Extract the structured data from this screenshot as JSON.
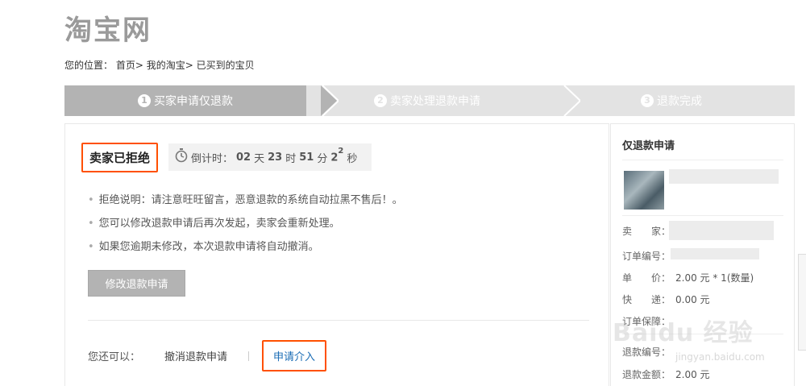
{
  "logo": "淘宝网",
  "breadcrumb": {
    "prefix": "您的位置：",
    "items": [
      "首页",
      "我的淘宝",
      "已买到的宝贝"
    ],
    "sep": "> "
  },
  "steps": [
    {
      "num": "1",
      "label": "买家申请仅退款"
    },
    {
      "num": "2",
      "label": "卖家处理退款申请"
    },
    {
      "num": "3",
      "label": "退款完成"
    }
  ],
  "status": {
    "title": "卖家已拒绝",
    "countdown_label": "倒计时：",
    "days": "02",
    "days_unit": "天",
    "hours": "23",
    "hours_unit": "时",
    "minutes": "51",
    "minutes_unit": "分",
    "seconds": "2",
    "seconds_sup": "2",
    "seconds_unit": "秒"
  },
  "notes": [
    "拒绝说明：请注意旺旺留言，恶意退款的系统自动拉黑不售后！。",
    "您可以修改退款申请后再次发起，卖家会重新处理。",
    "如果您逾期未修改，本次退款申请将自动撤消。"
  ],
  "modify_button": "修改退款申请",
  "actions": {
    "label": "您还可以：",
    "cancel": "撤消退款申请",
    "intervene": "申请介入"
  },
  "side": {
    "title": "仅退款申请",
    "seller_label": "卖　　家：",
    "order_no_label": "订单编号：",
    "price_label": "单　　价：",
    "price_value": "2.00 元 * 1(数量)",
    "shipping_label": "快　　递：",
    "shipping_value": "0.00 元",
    "guarantee_label": "订单保障：",
    "refund_no_label": "退款编号：",
    "refund_amount_label": "退款金额：",
    "refund_amount_value": "2.00 元"
  },
  "watermark": {
    "main": "Baidu 经验",
    "sub": "jingyan.baidu.com"
  },
  "colors": {
    "accent_orange": "#ff5000",
    "link_blue": "#1a6cb5",
    "step_active": "#b3b3b3",
    "step_inactive": "#e3e3e3"
  }
}
